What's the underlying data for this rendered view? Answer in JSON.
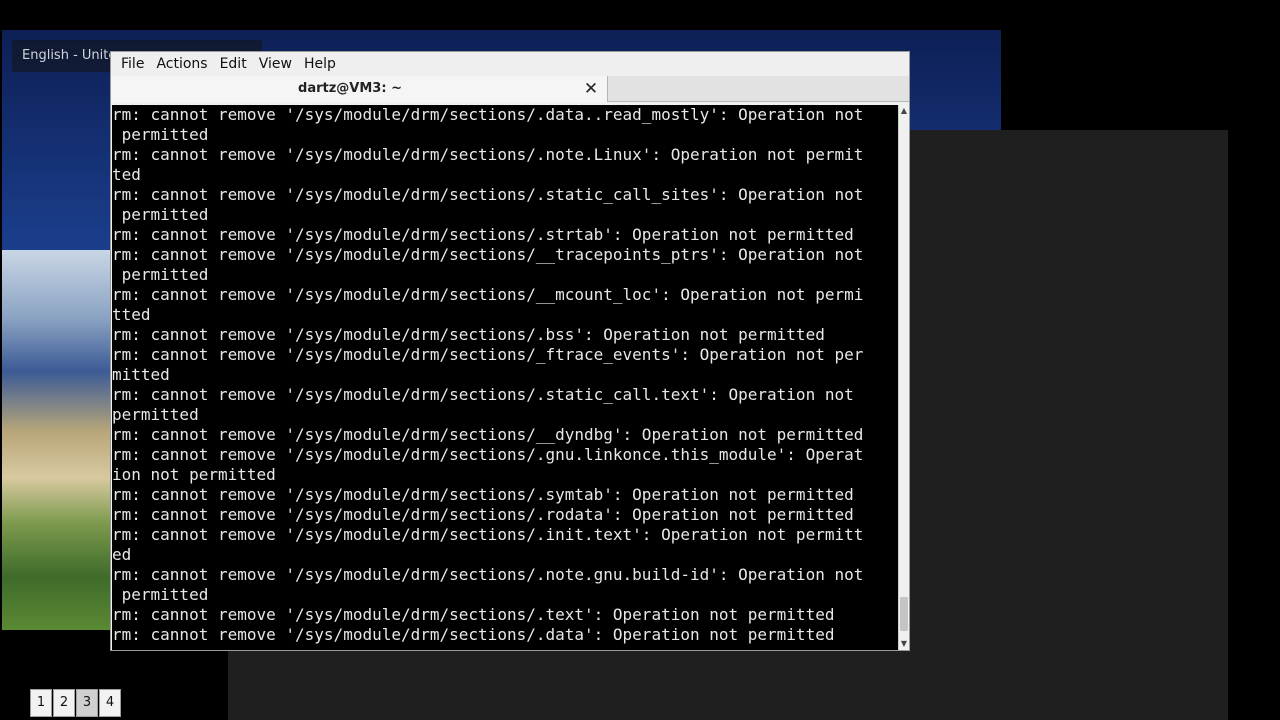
{
  "desktop": {
    "keyboard_layout": "English - Unite",
    "workspaces": [
      "1",
      "2",
      "3",
      "4"
    ],
    "active_workspace": "3"
  },
  "terminal": {
    "menu": [
      "File",
      "Actions",
      "Edit",
      "View",
      "Help"
    ],
    "tab_title": "dartz@VM3: ~",
    "close_glyph": "✕",
    "lines": [
      "rm: cannot remove '/sys/module/drm/sections/.data..read_mostly': Operation not",
      " permitted",
      "rm: cannot remove '/sys/module/drm/sections/.note.Linux': Operation not permit",
      "ted",
      "rm: cannot remove '/sys/module/drm/sections/.static_call_sites': Operation not",
      " permitted",
      "rm: cannot remove '/sys/module/drm/sections/.strtab': Operation not permitted",
      "rm: cannot remove '/sys/module/drm/sections/__tracepoints_ptrs': Operation not",
      " permitted",
      "rm: cannot remove '/sys/module/drm/sections/__mcount_loc': Operation not permi",
      "tted",
      "rm: cannot remove '/sys/module/drm/sections/.bss': Operation not permitted",
      "rm: cannot remove '/sys/module/drm/sections/_ftrace_events': Operation not per",
      "mitted",
      "rm: cannot remove '/sys/module/drm/sections/.static_call.text': Operation not",
      "permitted",
      "rm: cannot remove '/sys/module/drm/sections/__dyndbg': Operation not permitted",
      "rm: cannot remove '/sys/module/drm/sections/.gnu.linkonce.this_module': Operat",
      "ion not permitted",
      "rm: cannot remove '/sys/module/drm/sections/.symtab': Operation not permitted",
      "rm: cannot remove '/sys/module/drm/sections/.rodata': Operation not permitted",
      "rm: cannot remove '/sys/module/drm/sections/.init.text': Operation not permitt",
      "ed",
      "rm: cannot remove '/sys/module/drm/sections/.note.gnu.build-id': Operation not",
      " permitted",
      "rm: cannot remove '/sys/module/drm/sections/.text': Operation not permitted",
      "rm: cannot remove '/sys/module/drm/sections/.data': Operation not permitted"
    ]
  }
}
